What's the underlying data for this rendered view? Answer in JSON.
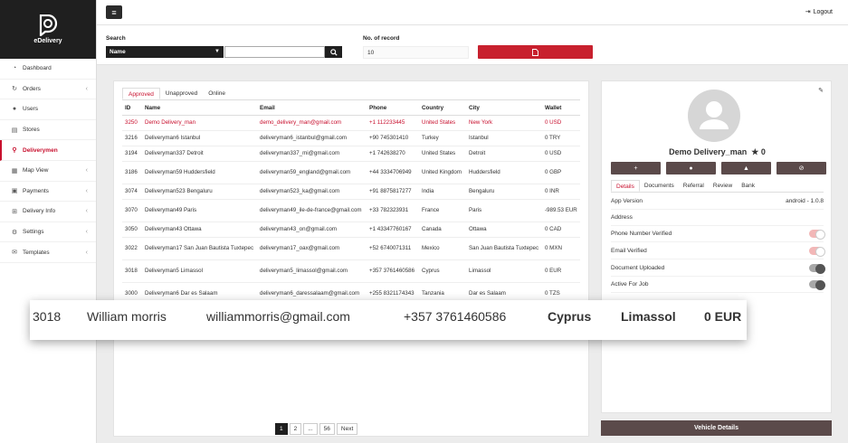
{
  "brand": {
    "name": "eDelivery"
  },
  "sidebar": {
    "items": [
      {
        "label": "Dashboard",
        "icon": "dashboard-icon",
        "chevron": false
      },
      {
        "label": "Orders",
        "icon": "orders-icon",
        "chevron": true
      },
      {
        "label": "Users",
        "icon": "user-icon",
        "chevron": false
      },
      {
        "label": "Stores",
        "icon": "store-icon",
        "chevron": false
      },
      {
        "label": "Deliverymen",
        "icon": "motorbike-icon",
        "chevron": false,
        "active": true
      },
      {
        "label": "Map View",
        "icon": "map-icon",
        "chevron": true
      },
      {
        "label": "Payments",
        "icon": "payments-icon",
        "chevron": true
      },
      {
        "label": "Delivery Info",
        "icon": "info-icon",
        "chevron": true
      },
      {
        "label": "Settings",
        "icon": "gear-icon",
        "chevron": true
      },
      {
        "label": "Templates",
        "icon": "template-icon",
        "chevron": true
      }
    ]
  },
  "header": {
    "logout_label": "Logout"
  },
  "search": {
    "label": "Search",
    "field_selected": "Name",
    "query": "",
    "records_label": "No. of record",
    "records_value": "10"
  },
  "table": {
    "tabs": [
      "Approved",
      "Unapproved",
      "Online"
    ],
    "columns": [
      "ID",
      "Name",
      "Email",
      "Phone",
      "Country",
      "City",
      "Wallet"
    ],
    "rows": [
      {
        "id": "3250",
        "name": "Demo Delivery_man",
        "email": "demo_delivery_man@gmail.com",
        "phone": "+1 112233445",
        "country": "United States",
        "city": "New York",
        "wallet": "0 USD"
      },
      {
        "id": "3216",
        "name": "Deliveryman6 Istanbul",
        "email": "deliveryman6_istanbul@gmail.com",
        "phone": "+90 745301410",
        "country": "Turkey",
        "city": "Istanbul",
        "wallet": "0 TRY"
      },
      {
        "id": "3194",
        "name": "Deliveryman337 Detroit",
        "email": "deliveryman337_mi@gmail.com",
        "phone": "+1 742638270",
        "country": "United States",
        "city": "Detroit",
        "wallet": "0 USD"
      },
      {
        "id": "3186",
        "name": "Deliveryman59 Huddersfield",
        "email": "deliveryman59_england@gmail.com",
        "phone": "+44 3334706949",
        "country": "United Kingdom",
        "city": "Huddersfield",
        "wallet": "0 GBP"
      },
      {
        "id": "3074",
        "name": "Deliveryman523 Bengaluru",
        "email": "deliveryman523_ka@gmail.com",
        "phone": "+91 8875817277",
        "country": "India",
        "city": "Bengaluru",
        "wallet": "0 INR"
      },
      {
        "id": "3070",
        "name": "Deliveryman49 Paris",
        "email": "deliveryman49_ile-de-france@gmail.com",
        "phone": "+33 782323931",
        "country": "France",
        "city": "Paris",
        "wallet": "-989.53 EUR"
      },
      {
        "id": "3050",
        "name": "Deliveryman43 Ottawa",
        "email": "deliveryman43_on@gmail.com",
        "phone": "+1 43347760167",
        "country": "Canada",
        "city": "Ottawa",
        "wallet": "0 CAD"
      },
      {
        "id": "3022",
        "name": "Deliveryman17 San Juan Bautista Tuxtepec",
        "email": "deliveryman17_oax@gmail.com",
        "phone": "+52 6740071311",
        "country": "Mexico",
        "city": "San Juan Bautista Tuxtepec",
        "wallet": "0 MXN"
      },
      {
        "id": "3018",
        "name": "Deliveryman5 Limassol",
        "email": "deliveryman5_limassol@gmail.com",
        "phone": "+357 3761460586",
        "country": "Cyprus",
        "city": "Limassol",
        "wallet": "0 EUR"
      },
      {
        "id": "3000",
        "name": "Deliveryman6 Dar es Salaam",
        "email": "deliveryman6_daressalaam@gmail.com",
        "phone": "+255 8321174343",
        "country": "Tanzania",
        "city": "Dar es Salaam",
        "wallet": "0 TZS"
      }
    ]
  },
  "pagination": [
    "1",
    "2",
    "...",
    "56",
    "Next"
  ],
  "profile": {
    "name": "Demo Delivery_man",
    "rating": "0",
    "tabs": [
      "Details",
      "Documents",
      "Referral",
      "Review",
      "Bank"
    ],
    "app_version_label": "App Version",
    "app_version_value": "android - 1.0.8",
    "address_label": "Address",
    "toggles": [
      {
        "label": "Phone Number Verified",
        "state": "off"
      },
      {
        "label": "Email Verified",
        "state": "off"
      },
      {
        "label": "Document Uploaded",
        "state": "on"
      },
      {
        "label": "Active For Job",
        "state": "on"
      }
    ],
    "vehicle_button": "Vehicle Details"
  },
  "zoom_row": {
    "id": "3018",
    "name": "William morris",
    "email": "williammorris@gmail.com",
    "phone": "+357 3761460586",
    "country": "Cyprus",
    "city": "Limassol",
    "wallet": "0 EUR"
  },
  "colors": {
    "accent": "#c8102e",
    "dark": "#1f1f1f",
    "brown": "#5b4a4a"
  }
}
